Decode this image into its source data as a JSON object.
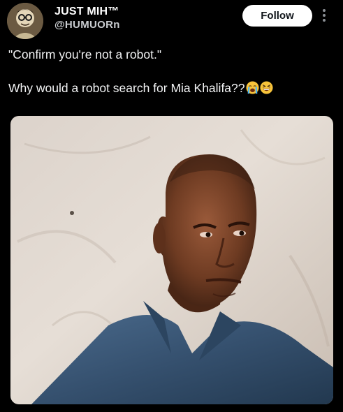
{
  "author": {
    "display_name": "JUST MIH™",
    "handle": "@HUMUORn"
  },
  "actions": {
    "follow_label": "Follow"
  },
  "tweet": {
    "line1": "\"Confirm you're not a robot.\"",
    "line2": "Why would a robot search for Mia Khalifa??",
    "emojis": [
      "loudly-crying-face-emoji",
      "grinning-squinting-face-emoji"
    ]
  },
  "media": {
    "type": "photo",
    "icon": "photo-of-man-looking-sideways"
  }
}
